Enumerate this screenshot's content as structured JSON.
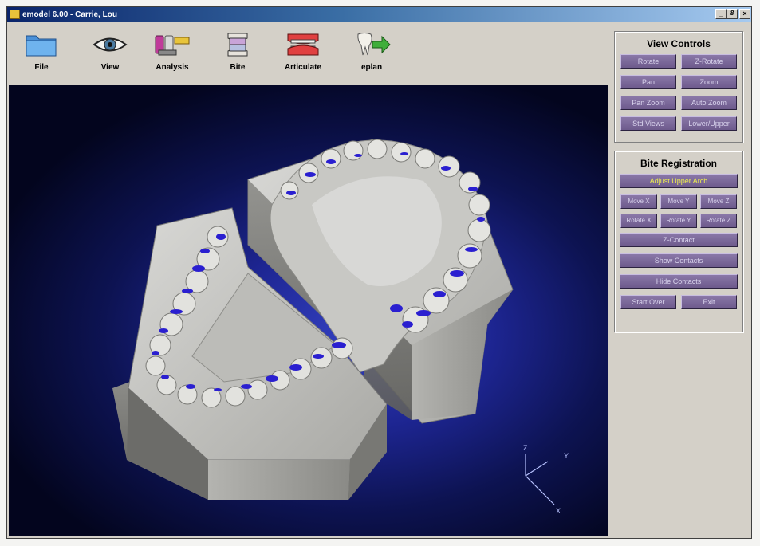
{
  "window": {
    "title": "emodel 6.00 - Carrie, Lou",
    "controls": {
      "minimize": "_",
      "restore": "8",
      "close": "×"
    }
  },
  "toolbar": {
    "items": [
      {
        "label": "File",
        "icon": "folder-icon"
      },
      {
        "label": "View",
        "icon": "eye-icon"
      },
      {
        "label": "Analysis",
        "icon": "caliper-icon"
      },
      {
        "label": "Bite",
        "icon": "bite-icon"
      },
      {
        "label": "Articulate",
        "icon": "articulator-icon"
      },
      {
        "label": "eplan",
        "icon": "tooth-arrow-icon"
      }
    ]
  },
  "axes": {
    "z": "Z",
    "y": "Y",
    "x": "X"
  },
  "view_controls": {
    "title": "View Controls",
    "rotate": "Rotate",
    "z_rotate": "Z-Rotate",
    "pan": "Pan",
    "zoom": "Zoom",
    "pan_zoom": "Pan Zoom",
    "auto_zoom": "Auto Zoom",
    "std_views": "Std Views",
    "lower_upper": "Lower/Upper"
  },
  "bite_registration": {
    "title": "Bite Registration",
    "adjust_upper_arch": "Adjust Upper Arch",
    "move_x": "Move X",
    "move_y": "Move Y",
    "move_z": "Move Z",
    "rotate_x": "Rotate X",
    "rotate_y": "Rotate Y",
    "rotate_z": "Rotate Z",
    "z_contact": "Z-Contact",
    "show_contacts": "Show Contacts",
    "hide_contacts": "Hide Contacts",
    "start_over": "Start Over",
    "exit": "Exit"
  },
  "colors": {
    "button_face": "#7a6898",
    "button_text": "#d8d2ec",
    "active_text": "#ecec50",
    "viewport_blue": "#1d2591",
    "contact_blue": "#2a1fd0"
  }
}
